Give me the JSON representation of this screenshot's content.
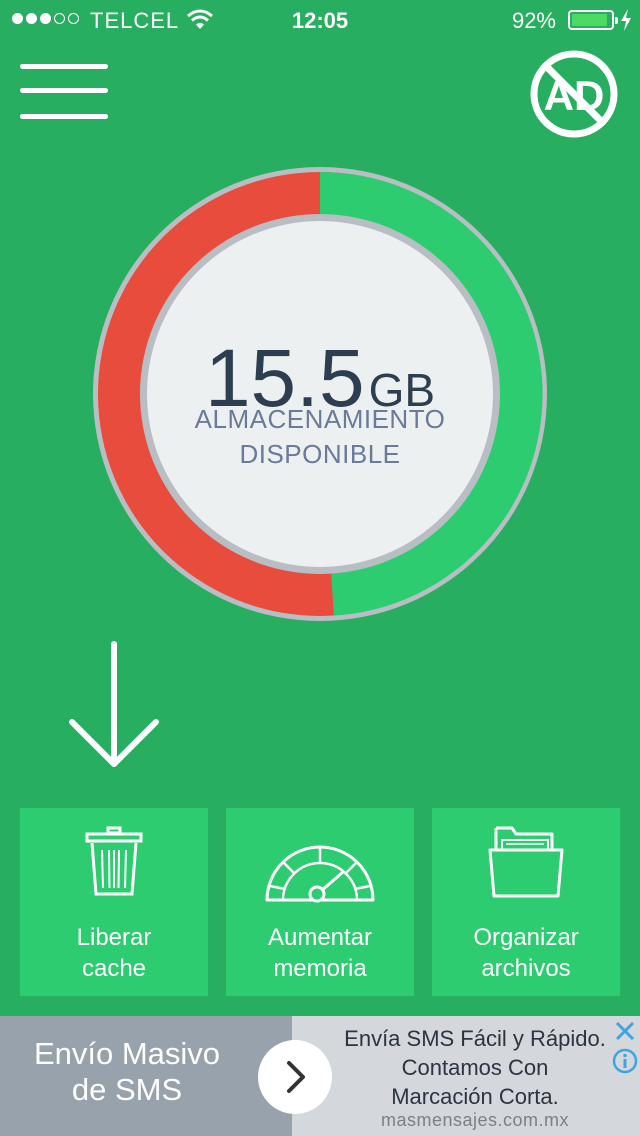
{
  "status_bar": {
    "carrier": "TELCEL",
    "time": "12:05",
    "battery_percent": "92%",
    "battery_level": 0.92,
    "signal_bars_filled": 3,
    "signal_bars_total": 5
  },
  "header": {
    "menu_icon": "hamburger-menu-icon",
    "no_ads_icon": "no-ads-icon",
    "no_ads_text": "AD"
  },
  "storage": {
    "value": "15.5",
    "unit": "GB",
    "label_line1": "ALMACENAMIENTO",
    "label_line2": "DISPONIBLE",
    "available_fraction": 0.49,
    "available_color": "#2ecc71",
    "used_color": "#e74c3c"
  },
  "actions": [
    {
      "line1": "Liberar",
      "line2": "cache",
      "icon": "trash-icon"
    },
    {
      "line1": "Aumentar",
      "line2": "memoria",
      "icon": "speedometer-icon"
    },
    {
      "line1": "Organizar",
      "line2": "archivos",
      "icon": "folder-icon"
    }
  ],
  "ad": {
    "left_line1": "Envío Masivo",
    "left_line2": "de SMS",
    "right_line1": "Envía SMS Fácil y Rápido.",
    "right_line2": "Contamos Con",
    "right_line3": "Marcación Corta.",
    "domain": "masmensajes.com.mx"
  },
  "colors": {
    "background": "#27ae60",
    "tile": "#2ecc71",
    "accent_blue": "#3fa4e0"
  }
}
